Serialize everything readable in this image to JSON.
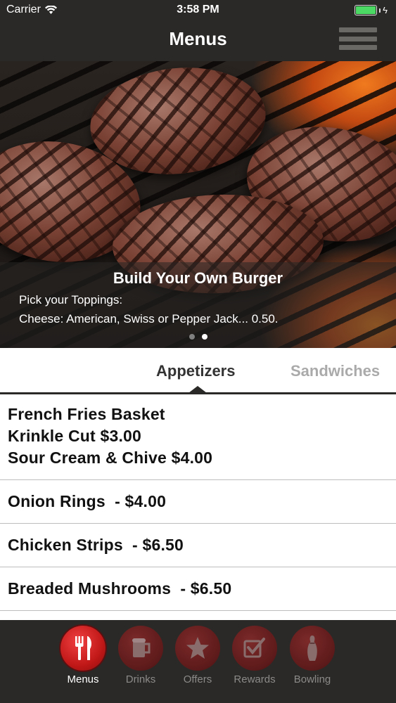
{
  "status_bar": {
    "carrier": "Carrier",
    "time": "3:58 PM"
  },
  "nav": {
    "title": "Menus"
  },
  "hero": {
    "title": "Build Your Own Burger",
    "line1": "Pick your Toppings:",
    "line2": "Cheese: American, Swiss or Pepper Jack... 0.50.",
    "page_count": 2,
    "active_page": 2
  },
  "tabs": {
    "active": "Appetizers",
    "next": "Sandwiches"
  },
  "menu_items": [
    {
      "lines": [
        "French Fries Basket",
        "Krinkle Cut $3.00",
        "Sour Cream & Chive $4.00"
      ]
    },
    {
      "text": "Onion Rings  - $4.00"
    },
    {
      "text": "Chicken Strips  - $6.50"
    },
    {
      "text": "Breaded Mushrooms  - $6.50"
    }
  ],
  "tabbar": [
    {
      "label": "Menus",
      "icon": "fork-knife-icon",
      "active": true
    },
    {
      "label": "Drinks",
      "icon": "mug-icon",
      "active": false
    },
    {
      "label": "Offers",
      "icon": "star-icon",
      "active": false
    },
    {
      "label": "Rewards",
      "icon": "checkbox-icon",
      "active": false
    },
    {
      "label": "Bowling",
      "icon": "bowling-pin-icon",
      "active": false
    }
  ],
  "colors": {
    "bar": "#2b2927",
    "accent": "#c11818",
    "battery": "#4cd964"
  }
}
